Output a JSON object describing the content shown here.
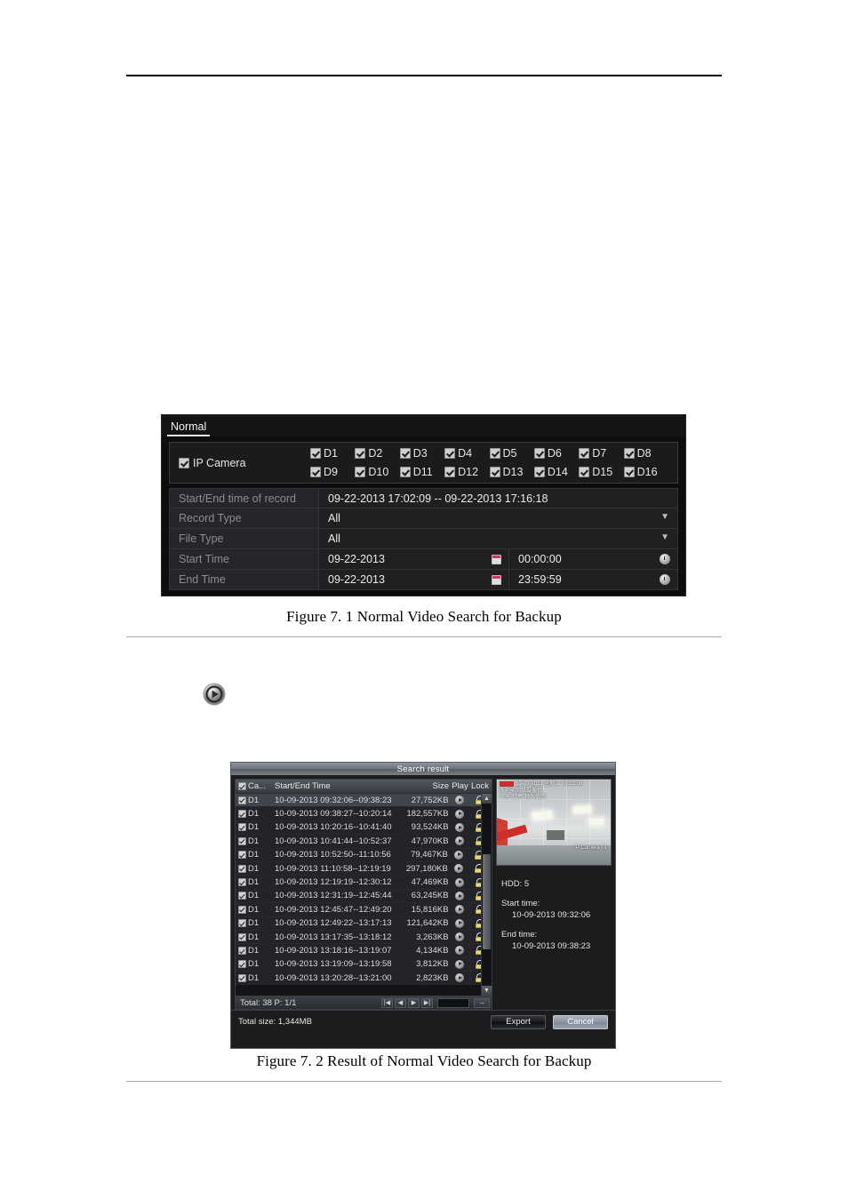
{
  "page": {
    "caption1": "Figure 7. 1  Normal Video Search for Backup",
    "caption2": "Figure 7. 2  Result of Normal Video Search for Backup",
    "play_icon": "play-circle-icon"
  },
  "dialog1": {
    "tab": "Normal",
    "ip_camera_label": "IP Camera",
    "cameras": [
      "D1",
      "D2",
      "D3",
      "D4",
      "D5",
      "D6",
      "D7",
      "D8",
      "D9",
      "D10",
      "D11",
      "D12",
      "D13",
      "D14",
      "D15",
      "D16"
    ],
    "rows": [
      {
        "label": "Start/End time of record",
        "value": "09-22-2013 17:02:09 -- 09-22-2013 17:16:18",
        "type": "static"
      },
      {
        "label": "Record Type",
        "value": "All",
        "type": "select"
      },
      {
        "label": "File Type",
        "value": "All",
        "type": "select"
      },
      {
        "label": "Start Time",
        "date": "09-22-2013",
        "time": "00:00:00",
        "type": "datetime"
      },
      {
        "label": "End Time",
        "date": "09-22-2013",
        "time": "23:59:59",
        "type": "datetime"
      }
    ]
  },
  "dialog2": {
    "title": "Search result",
    "columns": [
      "Ca...",
      "Start/End Time",
      "Size",
      "Play",
      "Lock"
    ],
    "rows": [
      {
        "cam": "D1",
        "time": "10-09-2013 09:32:06--09:38:23",
        "size": "27,752KB"
      },
      {
        "cam": "D1",
        "time": "10-09-2013 09:38:27--10:20:14",
        "size": "182,557KB"
      },
      {
        "cam": "D1",
        "time": "10-09-2013 10:20:16--10:41:40",
        "size": "93,524KB"
      },
      {
        "cam": "D1",
        "time": "10-09-2013 10:41:44--10:52:37",
        "size": "47,970KB"
      },
      {
        "cam": "D1",
        "time": "10-09-2013 10:52:50--11:10:56",
        "size": "79,467KB"
      },
      {
        "cam": "D1",
        "time": "10-09-2013 11:10:58--12:19:19",
        "size": "297,180KB"
      },
      {
        "cam": "D1",
        "time": "10-09-2013 12:19:19--12:30:12",
        "size": "47,469KB"
      },
      {
        "cam": "D1",
        "time": "10-09-2013 12:31:19--12:45:44",
        "size": "63,245KB"
      },
      {
        "cam": "D1",
        "time": "10-09-2013 12:45:47--12:49:20",
        "size": "15,816KB"
      },
      {
        "cam": "D1",
        "time": "10-09-2013 12:49:22--13:17:13",
        "size": "121,642KB"
      },
      {
        "cam": "D1",
        "time": "10-09-2013 13:17:35--13:18:12",
        "size": "3,263KB"
      },
      {
        "cam": "D1",
        "time": "10-09-2013 13:18:16--13:19:07",
        "size": "4,134KB"
      },
      {
        "cam": "D1",
        "time": "10-09-2013 13:19:09--13:19:58",
        "size": "3,812KB"
      },
      {
        "cam": "D1",
        "time": "10-09-2013 13:20:28--13:21:00",
        "size": "2,823KB"
      }
    ],
    "footer_total": "Total: 38  P: 1/1",
    "pager": {
      "first": "|◀",
      "prev": "◀",
      "next": "▶",
      "last": "▶|",
      "go": "→",
      "page_value": ""
    },
    "preview": {
      "osd_line1": "10-09-2013 星期二  09:32:06",
      "osd_line2": "多功能网络摄像机",
      "osd_line3": "人来·灯亮·预为侦查",
      "osd_corner": "IP Camera 01"
    },
    "info": {
      "hdd_label": "HDD: 5",
      "start_label": "Start time:",
      "start_value": "10-09-2013 09:32:06",
      "end_label": "End time:",
      "end_value": "10-09-2013 09:38:23"
    },
    "total_size": "Total size: 1,344MB",
    "export_label": "Export",
    "cancel_label": "Cancel"
  }
}
